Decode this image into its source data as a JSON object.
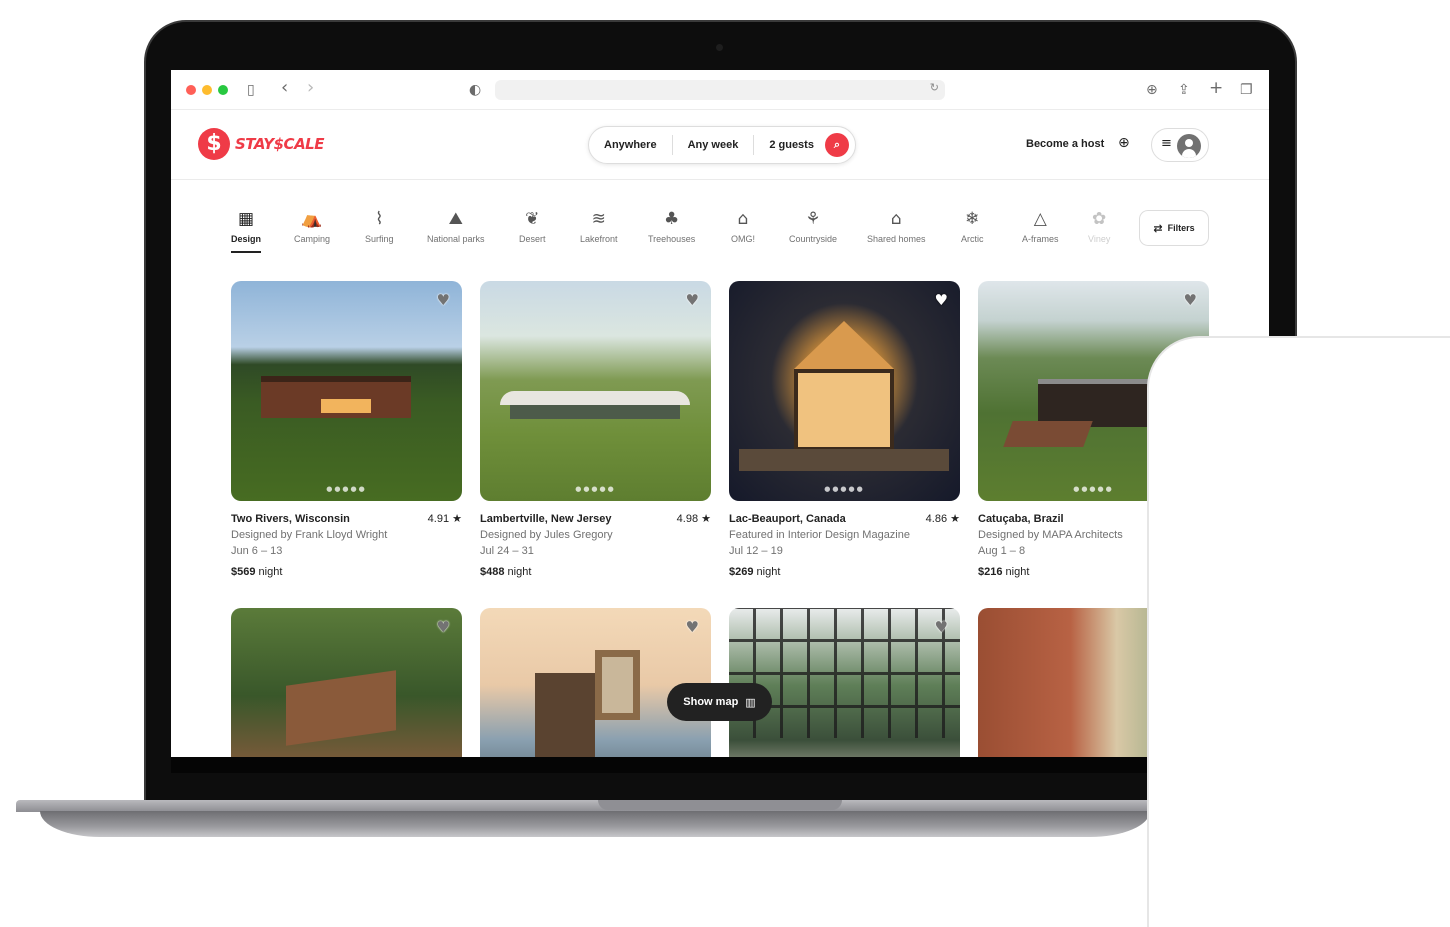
{
  "browser": {
    "sidebar_icon": "▯",
    "back_icon": "‹",
    "forward_icon": "›",
    "shield_icon": "◐",
    "reload_icon": "↻",
    "download_icon": "⊕",
    "share_icon": "⇪",
    "new_tab_icon": "+",
    "tabs_icon": "❐"
  },
  "header": {
    "logo_mark": "$",
    "logo_text": "STAY$CALE",
    "search": {
      "where": "Anywhere",
      "when": "Any week",
      "guests": "2 guests",
      "search_icon": "⌕"
    },
    "host_link": "Become a host",
    "globe_icon": "⊕",
    "menu_icon": "≡"
  },
  "categories": [
    {
      "label": "Design",
      "icon": "▦"
    },
    {
      "label": "Camping",
      "icon": "⛺"
    },
    {
      "label": "Surfing",
      "icon": "⌇"
    },
    {
      "label": "National parks",
      "icon": "⛰"
    },
    {
      "label": "Desert",
      "icon": "❦"
    },
    {
      "label": "Lakefront",
      "icon": "≋"
    },
    {
      "label": "Treehouses",
      "icon": "♣"
    },
    {
      "label": "OMG!",
      "icon": "⌂"
    },
    {
      "label": "Countryside",
      "icon": "⚘"
    },
    {
      "label": "Shared homes",
      "icon": "⌂"
    },
    {
      "label": "Arctic",
      "icon": "❄"
    },
    {
      "label": "A-frames",
      "icon": "△"
    },
    {
      "label": "Viney",
      "icon": "✿"
    }
  ],
  "filters": {
    "label": "Filters",
    "icon": "⇄"
  },
  "listings": [
    {
      "location": "Two Rivers, Wisconsin",
      "rating": "4.91 ★",
      "subtitle": "Designed by Frank Lloyd Wright",
      "dates": "Jun 6 – 13",
      "price": "$569",
      "price_unit": " night"
    },
    {
      "location": "Lambertville, New Jersey",
      "rating": "4.98 ★",
      "subtitle": "Designed by Jules Gregory",
      "dates": "Jul 24 – 31",
      "price": "$488",
      "price_unit": " night"
    },
    {
      "location": "Lac-Beauport, Canada",
      "rating": "4.86 ★",
      "subtitle": "Featured in Interior Design Magazine",
      "dates": "Jul 12 – 19",
      "price": "$269",
      "price_unit": " night"
    },
    {
      "location": "Catuçaba, Brazil",
      "rating": "",
      "subtitle": "Designed by MAPA Architects",
      "dates": "Aug 1 – 8",
      "price": "$216",
      "price_unit": " night"
    }
  ],
  "card_ui": {
    "heart_icon": "♥",
    "dots": "●●●●●"
  },
  "show_map": {
    "label": "Show map",
    "icon": "▥"
  },
  "colors": {
    "brand": "#ef3b47",
    "text": "#222222",
    "muted": "#717171"
  }
}
